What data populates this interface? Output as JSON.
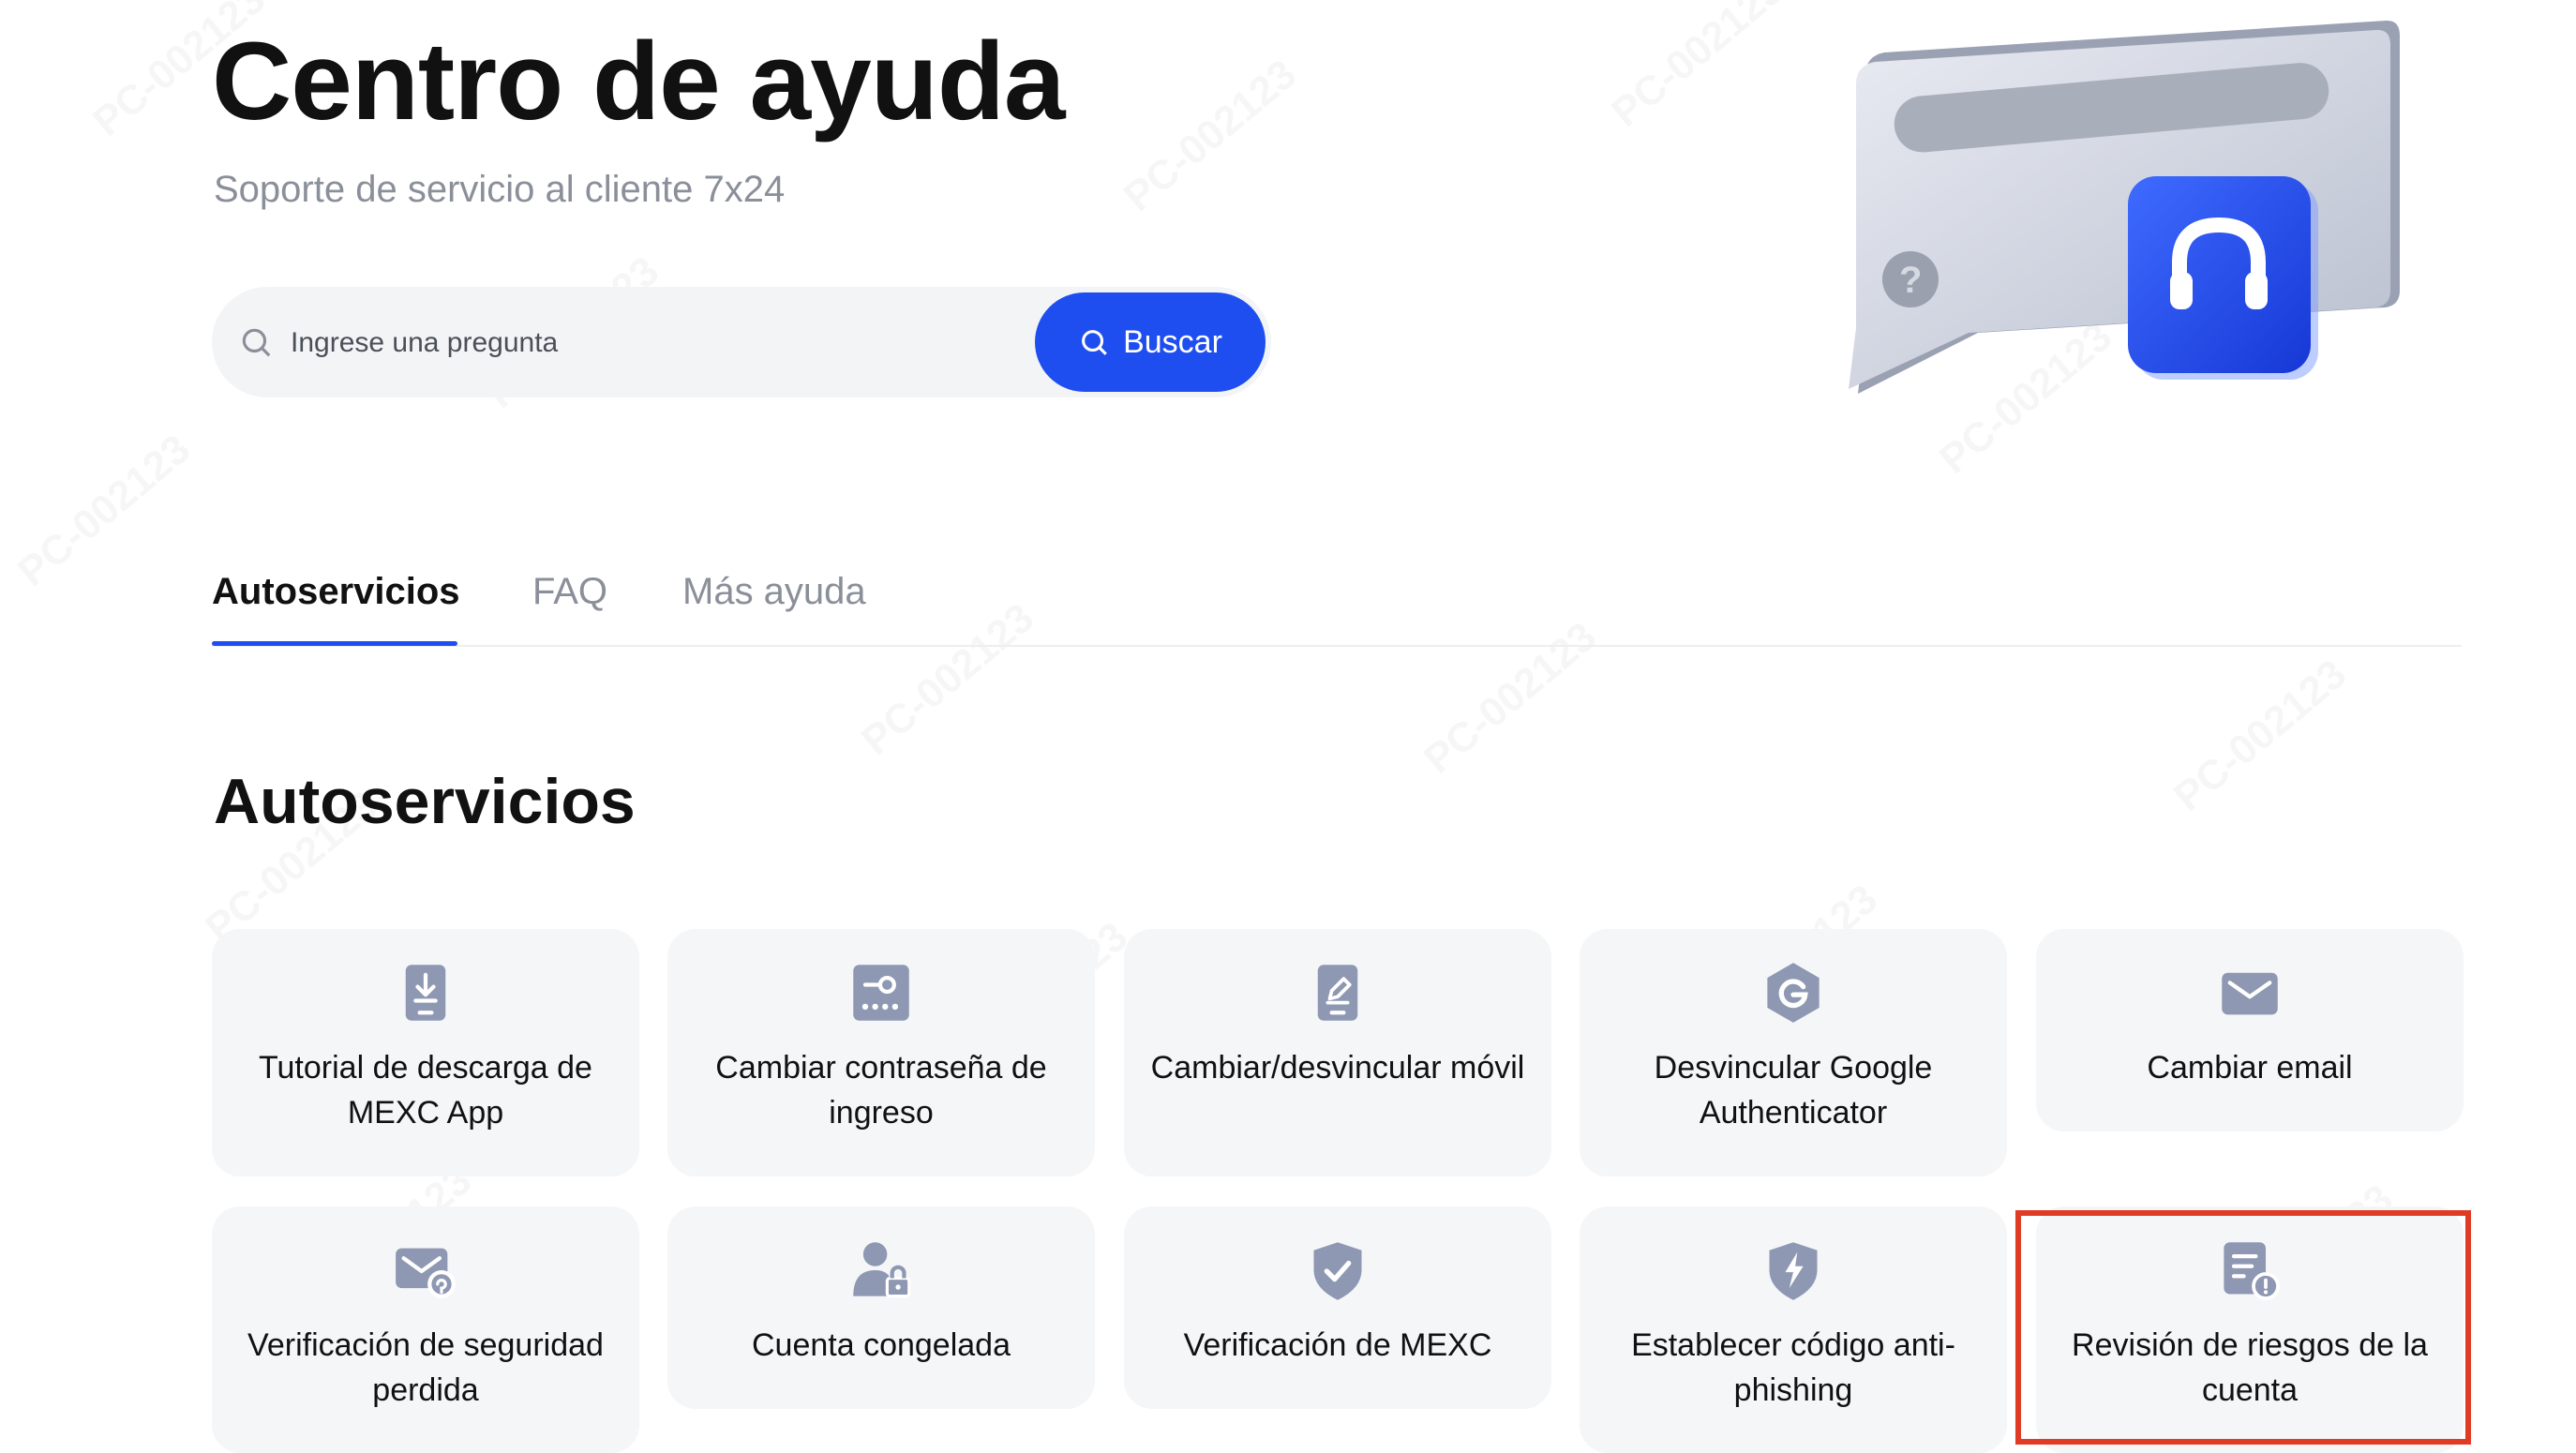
{
  "hero": {
    "title": "Centro de ayuda",
    "subtitle": "Soporte de servicio al cliente 7x24"
  },
  "search": {
    "placeholder": "Ingrese una pregunta",
    "button_label": "Buscar"
  },
  "tabs": [
    {
      "label": "Autoservicios",
      "active": true
    },
    {
      "label": "FAQ",
      "active": false
    },
    {
      "label": "Más ayuda",
      "active": false
    }
  ],
  "section": {
    "title": "Autoservicios"
  },
  "cards": [
    {
      "label": "Tutorial de descarga de MEXC App",
      "icon": "download-icon"
    },
    {
      "label": "Cambiar contraseña de ingreso",
      "icon": "password-icon"
    },
    {
      "label": "Cambiar/desvincular móvil",
      "icon": "phone-edit-icon"
    },
    {
      "label": "Desvincular Google Authenticator",
      "icon": "google-icon"
    },
    {
      "label": "Cambiar email",
      "icon": "email-icon"
    },
    {
      "label": "Verificación de seguridad perdida",
      "icon": "mail-security-icon"
    },
    {
      "label": "Cuenta congelada",
      "icon": "user-lock-icon"
    },
    {
      "label": "Verificación de MEXC",
      "icon": "shield-check-icon"
    },
    {
      "label": "Establecer código anti-phishing",
      "icon": "shield-bolt-icon"
    },
    {
      "label": "Revisión de riesgos de la cuenta",
      "icon": "document-alert-icon"
    }
  ],
  "watermark_text": "PC-002123",
  "colors": {
    "accent": "#1f4ef0",
    "card_background": "#f5f6f8",
    "icon_color": "#8e98b3",
    "highlight": "#e03b24"
  }
}
